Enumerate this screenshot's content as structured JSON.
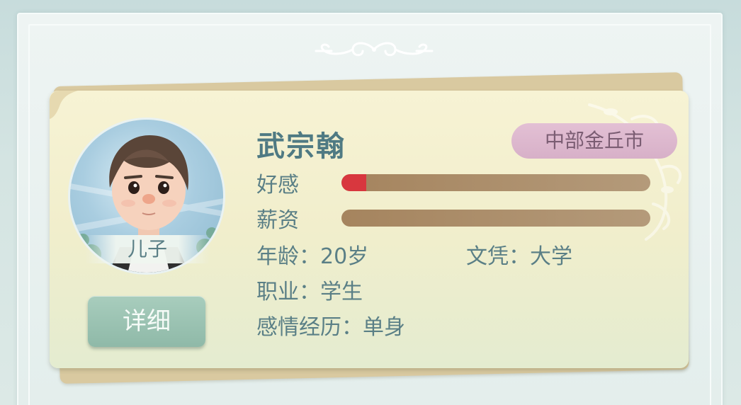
{
  "card": {
    "name": "武宗翰",
    "relation": "儿子",
    "location": "中部金丘市",
    "detail_button": "详细",
    "stats": {
      "affection_label": "好感",
      "affection_level": 0.08,
      "salary_label": "薪资",
      "salary_level": 0.0
    },
    "age_line": "年龄：20岁",
    "education_line": "文凭：大学",
    "occupation_line": "职业：学生",
    "relationship_line": "感情经历：单身"
  },
  "colors": {
    "affection_fill": "#d8373e",
    "bar_track": "#a5845e",
    "name_text": "#4f7a83",
    "badge_bg": "#dcb8cd",
    "button_bg": "#9cc4b3"
  },
  "icons": {
    "header_ornament": "scroll-ornament-icon",
    "card_decoration": "vine-decoration-icon"
  }
}
